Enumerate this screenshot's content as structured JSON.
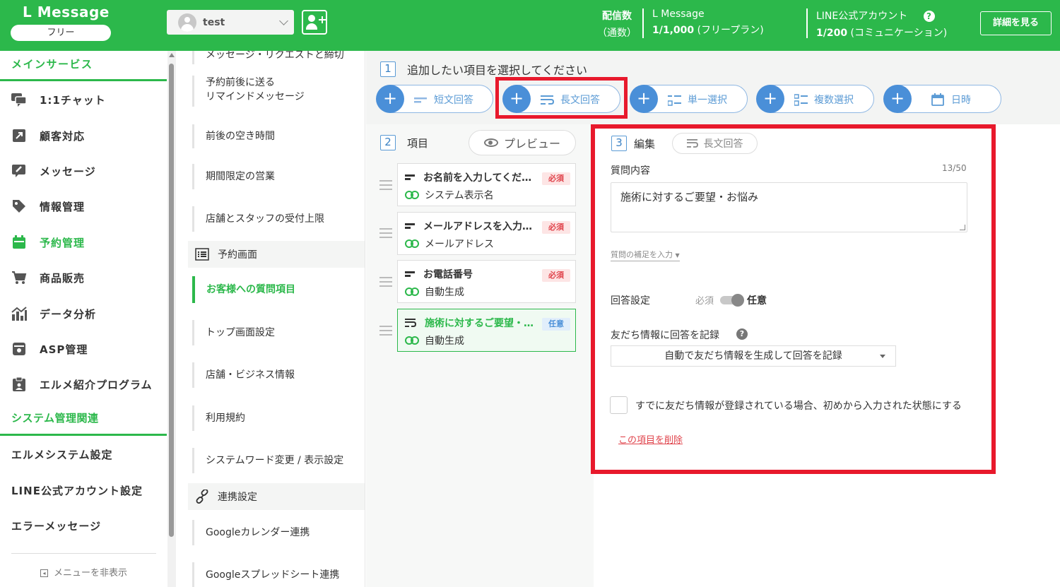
{
  "header": {
    "logo": "L Message",
    "plan_pill": "フリー",
    "account_name": "test",
    "delivery_label_1": "配信数",
    "delivery_label_2": "（通数）",
    "lmessage_title": "L Message",
    "lmessage_count": "1/1,000",
    "lmessage_plan": "(フリープラン)",
    "line_title": "LINE公式アカウント",
    "line_count": "1/200",
    "line_plan": "(コミュニケーション)",
    "help_glyph": "?",
    "detail_button": "詳細を見る"
  },
  "sidebar": {
    "section_main": "メインサービス",
    "items": [
      {
        "label": "1:1チャット",
        "icon": "chat-icon"
      },
      {
        "label": "顧客対応",
        "icon": "external-link-icon"
      },
      {
        "label": "メッセージ",
        "icon": "message-edit-icon"
      },
      {
        "label": "情報管理",
        "icon": "tag-icon"
      },
      {
        "label": "予約管理",
        "icon": "calendar-icon"
      },
      {
        "label": "商品販売",
        "icon": "cart-icon"
      },
      {
        "label": "データ分析",
        "icon": "bar-chart-icon"
      },
      {
        "label": "ASP管理",
        "icon": "asp-icon"
      },
      {
        "label": "エルメ紹介プログラム",
        "icon": "clipboard-icon"
      }
    ],
    "section_system": "システム管理関連",
    "system_items": [
      "エルメシステム設定",
      "LINE公式アカウント設定",
      "エラーメッセージ"
    ],
    "hide_menu": "メニューを非表示"
  },
  "subnav": {
    "items": [
      "メッセージ・リクエストと締切",
      "予約前後に送る",
      "リマインドメッセージ",
      "前後の空き時間",
      "期間限定の営業",
      "店舗とスタッフの受付上限"
    ],
    "group_booking": "予約画面",
    "active_item": "お客様への質問項目",
    "booking_items": [
      "トップ画面設定",
      "店舗・ビジネス情報",
      "利用規約",
      "システムワード変更 / 表示設定"
    ],
    "group_link": "連携設定",
    "link_items": [
      "Googleカレンダー連携",
      "Googleスプレッドシート連携"
    ]
  },
  "step1": {
    "num": "1",
    "title": "追加したい項目を選択してください",
    "types": [
      {
        "label": "短文回答",
        "icon": "short-text-icon"
      },
      {
        "label": "長文回答",
        "icon": "long-text-icon"
      },
      {
        "label": "単一選択",
        "icon": "single-select-icon"
      },
      {
        "label": "複数選択",
        "icon": "multi-select-icon"
      },
      {
        "label": "日時",
        "icon": "calendar-icon"
      }
    ]
  },
  "step2": {
    "num": "2",
    "title": "項目",
    "preview": "プレビュー",
    "questions": [
      {
        "title": "お名前を入力してくだ…",
        "sub": "システム表示名",
        "badge": "必須"
      },
      {
        "title": "メールアドレスを入力…",
        "sub": "メールアドレス",
        "badge": "必須"
      },
      {
        "title": "お電話番号",
        "sub": "自動生成",
        "badge": "必須"
      },
      {
        "title": "施術に対するご要望・…",
        "sub": "自動生成",
        "badge": "任意"
      }
    ]
  },
  "step3": {
    "num": "3",
    "title": "編集",
    "type_pill": "長文回答",
    "question_label": "質問内容",
    "counter": "13/50",
    "question_value": "施術に対するご要望・お悩み",
    "supplement": "質問の補足を入力",
    "answer_setting": "回答設定",
    "required": "必須",
    "optional": "任意",
    "record_label": "友だち情報に回答を記録",
    "record_select": "自動で友だち情報を生成して回答を記録",
    "prefill_label": "すでに友だち情報が登録されている場合、初めから入力された状態にする",
    "delete_link": "この項目を削除"
  },
  "colors": {
    "brand_green": "#2cb84b",
    "accent_blue": "#4a8fd8",
    "highlight_red": "#e8192c"
  }
}
